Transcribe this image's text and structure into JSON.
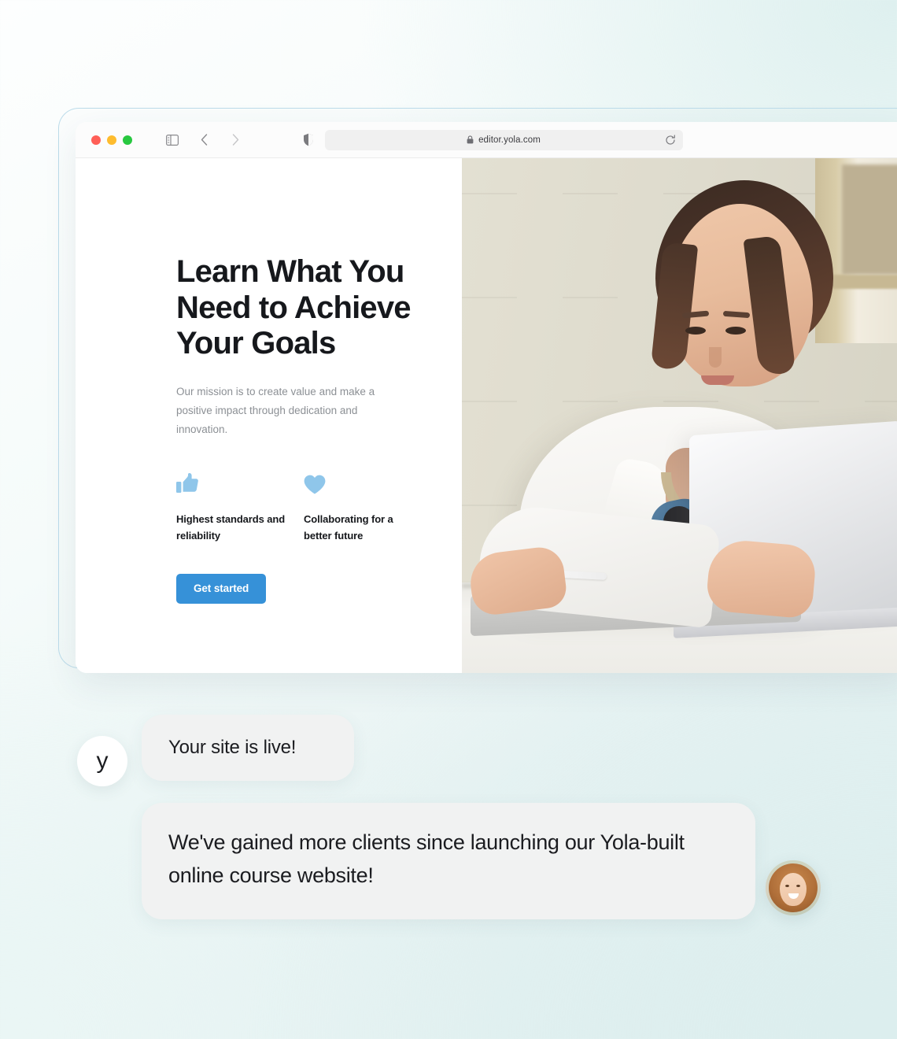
{
  "browser": {
    "window_controls": [
      "close",
      "minimize",
      "maximize"
    ],
    "sidebar_icon": "sidebar-toggle-icon",
    "back_icon": "chevron-left-icon",
    "forward_icon": "chevron-right-icon",
    "shield_icon": "privacy-shield-icon",
    "lock_icon": "lock-icon",
    "reload_icon": "reload-icon",
    "url": "editor.yola.com"
  },
  "hero": {
    "title": "Learn What You Need to Achieve Your Goals",
    "subtitle": "Our mission is to create value and make a positive impact through dedication and innovation.",
    "features": [
      {
        "icon": "thumbs-up-icon",
        "label": "Highest standards and reliability"
      },
      {
        "icon": "heart-icon",
        "label": "Collaborating for a better future"
      }
    ],
    "cta_label": "Get started",
    "image_alt": "Woman with blue headphones working on a laptop at a white desk"
  },
  "chat": {
    "brand_avatar_letter": "y",
    "messages": [
      {
        "text": "Your site is live!"
      },
      {
        "text": "We've gained more clients since launching our Yola-built online course website!"
      }
    ],
    "user_avatar": "customer-photo-avatar"
  },
  "colors": {
    "accent_blue": "#3691D8",
    "icon_blue": "#8FC6EA",
    "bubble_gray": "#F1F2F2",
    "heading_dark": "#16181C",
    "body_gray": "#8C9095",
    "frame_border": "#BCDCEA"
  }
}
